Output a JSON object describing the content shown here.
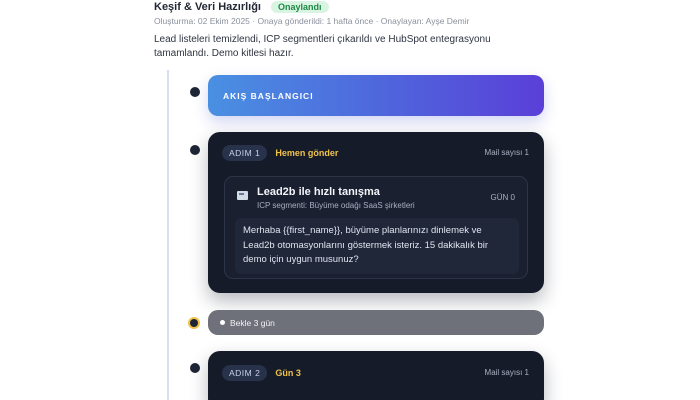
{
  "header": {
    "title": "Keşif & Veri Hazırlığı",
    "status_badge": "Onaylandı",
    "meta": "Oluşturma: 02 Ekim 2025 · Onaya gönderildi: 1 hafta önce · Onaylayan: Ayşe Demir",
    "description": "Lead listeleri temizlendi, ICP segmentleri çıkarıldı ve HubSpot entegrasyonu tamamlandı. Demo kitlesi hazır."
  },
  "flow": {
    "start_label": "AKIŞ BAŞLANGICI",
    "steps": [
      {
        "pill": "ADIM 1",
        "when": "Hemen gönder",
        "mail_count": "Mail sayısı 1",
        "message": {
          "title": "Lead2b ile hızlı tanışma",
          "subtitle": "ICP segmenti: Büyüme odağı SaaS şirketleri",
          "day": "GÜN 0",
          "body": "Merhaba {{first_name}}, büyüme planlarınızı dinlemek ve Lead2b otomasyonlarını göstermek isteriz. 15 dakikalık bir demo için uygun musunuz?"
        }
      },
      {
        "pill": "ADIM 2",
        "when": "Gün 3",
        "mail_count": "Mail sayısı 1"
      }
    ],
    "wait_label": "Bekle 3 gün"
  },
  "icons": {
    "message": "email-icon",
    "wait": "pause-dot-icon"
  },
  "colors": {
    "accent_gradient_start": "#4a90e2",
    "accent_gradient_end": "#5b3fd8",
    "step_bg": "#161b29",
    "highlight": "#f1c24a",
    "badge_green": "#1e8a44"
  }
}
